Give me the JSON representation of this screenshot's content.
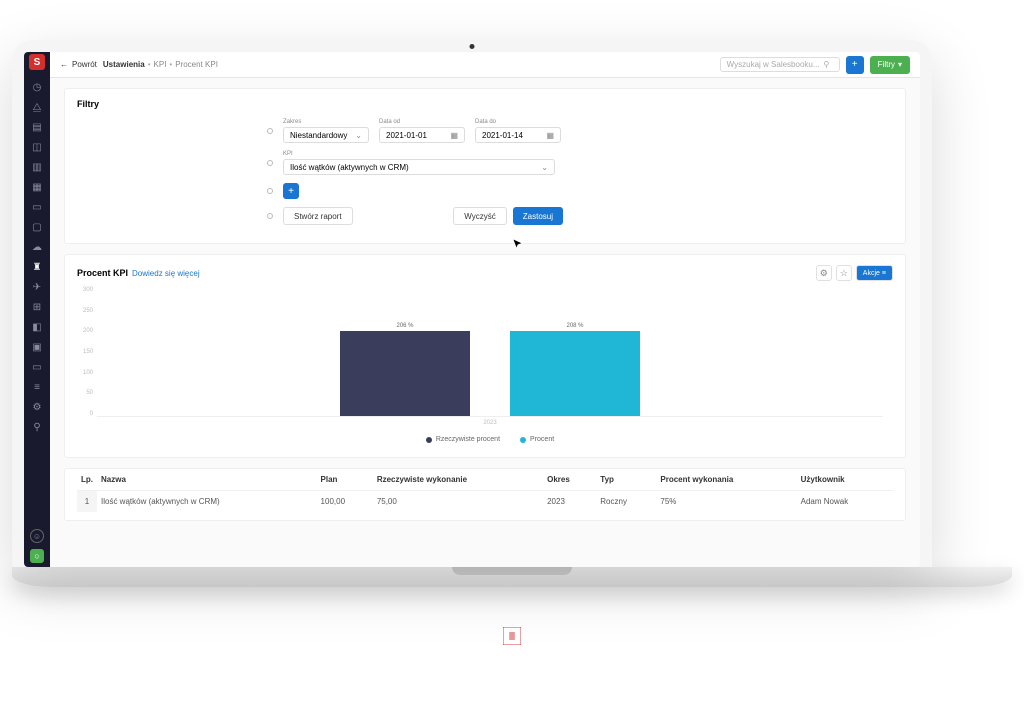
{
  "topbar": {
    "back": "Powrót",
    "crumb1": "Ustawienia",
    "crumb2": "KPI",
    "crumb3": "Procent KPI",
    "search_placeholder": "Wyszukaj w Salesbooku...",
    "filters_btn": "Filtry"
  },
  "filters": {
    "title": "Filtry",
    "range_label": "Zakres",
    "range_value": "Niestandardowy",
    "date_from_label": "Data od",
    "date_from_value": "2021-01-01",
    "date_to_label": "Data do",
    "date_to_value": "2021-01-14",
    "kpi_label": "KPI",
    "kpi_value": "Ilość wątków (aktywnych w CRM)",
    "create_report": "Stwórz raport",
    "clear": "Wyczyść",
    "apply": "Zastosuj"
  },
  "chart_panel": {
    "title": "Procent KPI",
    "more": "Dowiedz się więcej",
    "actions_btn": "Akcje"
  },
  "chart_data": {
    "type": "bar",
    "categories": [
      "Rzeczywiste procent",
      "Procent"
    ],
    "series": [
      {
        "name": "Rzeczywiste procent",
        "value": 206,
        "label": "206 %",
        "color": "#3a3d5c"
      },
      {
        "name": "Procent",
        "value": 208,
        "label": "208 %",
        "color": "#20b6d6"
      }
    ],
    "ylim": [
      0,
      300
    ],
    "yticks": [
      0,
      50,
      100,
      150,
      200,
      250,
      300
    ],
    "x_category": "2023",
    "legend": [
      "Rzeczywiste procent",
      "Procent"
    ]
  },
  "table": {
    "headers": {
      "lp": "Lp.",
      "name": "Nazwa",
      "plan": "Plan",
      "actual": "Rzeczywiste wykonanie",
      "period": "Okres",
      "type": "Typ",
      "percent": "Procent wykonania",
      "user": "Użytkownik"
    },
    "rows": [
      {
        "lp": "1",
        "name": "Ilość wątków (aktywnych w CRM)",
        "plan": "100,00",
        "actual": "75,00",
        "period": "2023",
        "type": "Roczny",
        "percent": "75%",
        "user": "Adam Nowak"
      }
    ]
  }
}
